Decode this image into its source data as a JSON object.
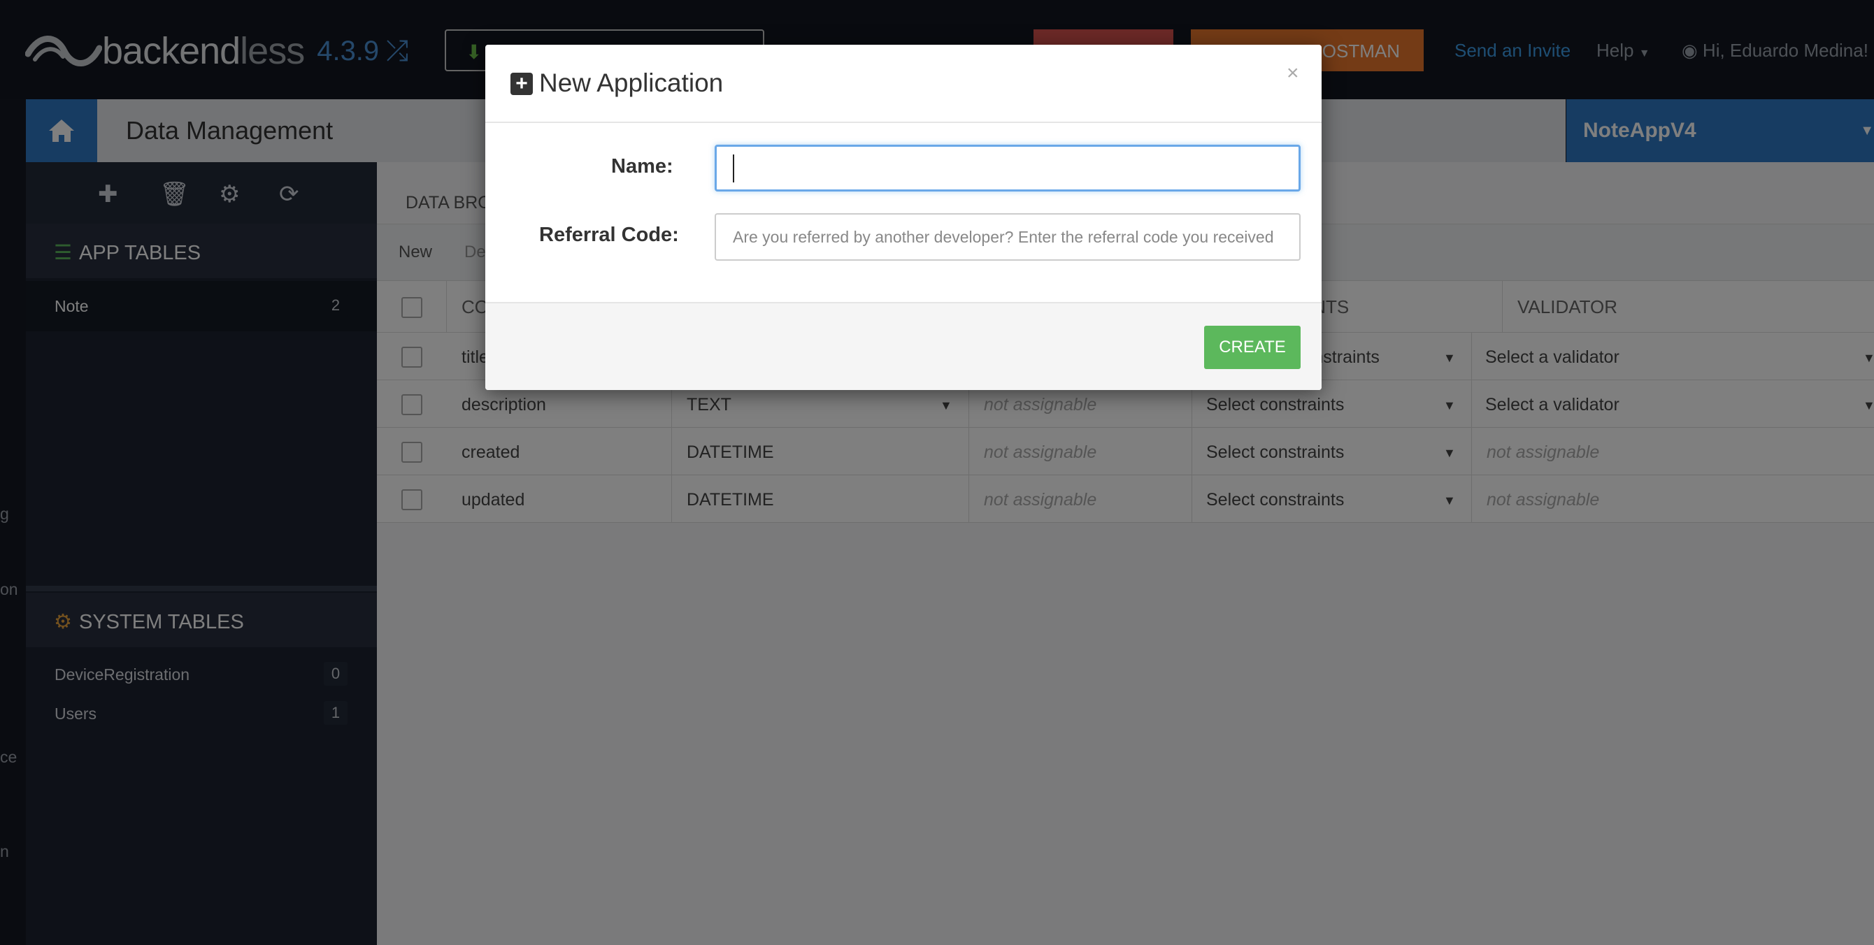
{
  "topbar": {
    "logo_main": "backend",
    "logo_suffix": "less",
    "version": "4.3.9",
    "invite": "Send an Invite",
    "help": "Help",
    "user": "Hi, Eduardo Medina!",
    "orange_btn": "POSTMAN"
  },
  "header": {
    "title": "Data Management",
    "app_name": "NoteAppV4"
  },
  "sidebar": {
    "app_tables_title": "APP TABLES",
    "app_tables": [
      {
        "name": "Note",
        "count": "2"
      }
    ],
    "system_tables_title": "SYSTEM TABLES",
    "system_tables": [
      {
        "name": "DeviceRegistration",
        "count": "0"
      },
      {
        "name": "Users",
        "count": "1"
      }
    ]
  },
  "left_edge": [
    "g",
    "on",
    "ce",
    "n"
  ],
  "main": {
    "browser_tab": "DATA BRO",
    "new_action": "New",
    "delete_action": "De",
    "headers": {
      "col1": "CO",
      "col4": "INTS",
      "col5": "VALIDATOR"
    },
    "rows": [
      {
        "name": "title",
        "type": "",
        "default": "",
        "constraints": "constraints",
        "validator": "Select a validator"
      },
      {
        "name": "description",
        "type": "TEXT",
        "default": "not assignable",
        "constraints": "Select constraints",
        "validator": "Select a validator"
      },
      {
        "name": "created",
        "type": "DATETIME",
        "default": "not assignable",
        "constraints": "Select constraints",
        "validator": "not assignable"
      },
      {
        "name": "updated",
        "type": "DATETIME",
        "default": "not assignable",
        "constraints": "Select constraints",
        "validator": "not assignable"
      }
    ]
  },
  "modal": {
    "title": "New Application",
    "close": "×",
    "name_label": "Name:",
    "name_value": "",
    "referral_label": "Referral Code:",
    "referral_placeholder": "Are you referred by another developer? Enter the referral code you received",
    "create": "CREATE"
  },
  "colors": {
    "accent_blue": "#2e78c4",
    "create_green": "#5cb85c",
    "orange": "#e8762c",
    "red": "#d9534f"
  }
}
